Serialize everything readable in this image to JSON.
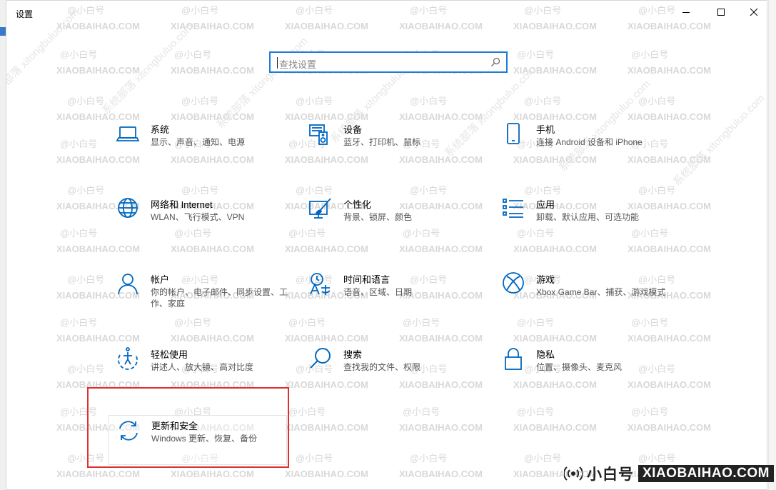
{
  "window": {
    "title": "设置",
    "controls": {
      "minimize": "minimize",
      "maximize": "maximize",
      "close": "close"
    }
  },
  "watermark": {
    "handle": "@小白号",
    "site": "XIAOBAIHAO.COM",
    "diag": "系统部落 xitongbuluo.com",
    "color": "#d8d8d8"
  },
  "search": {
    "placeholder": "查找设置"
  },
  "accent": "#0067c0",
  "tiles": [
    {
      "id": "system",
      "title": "系统",
      "desc": "显示、声音、通知、电源",
      "icon": "laptop-icon"
    },
    {
      "id": "devices",
      "title": "设备",
      "desc": "蓝牙、打印机、鼠标",
      "icon": "devices-icon"
    },
    {
      "id": "phone",
      "title": "手机",
      "desc": "连接 Android 设备和 iPhone",
      "icon": "phone-icon"
    },
    {
      "id": "network",
      "title": "网络和 Internet",
      "desc": "WLAN、飞行模式、VPN",
      "icon": "globe-icon"
    },
    {
      "id": "personalization",
      "title": "个性化",
      "desc": "背景、锁屏、颜色",
      "icon": "paint-icon"
    },
    {
      "id": "apps",
      "title": "应用",
      "desc": "卸载、默认应用、可选功能",
      "icon": "apps-list-icon"
    },
    {
      "id": "accounts",
      "title": "帐户",
      "desc": "你的帐户、电子邮件、同步设置、工作、家庭",
      "icon": "person-icon"
    },
    {
      "id": "time-language",
      "title": "时间和语言",
      "desc": "语音、区域、日期",
      "icon": "time-language-icon"
    },
    {
      "id": "gaming",
      "title": "游戏",
      "desc": "Xbox Game Bar、捕获、游戏模式",
      "icon": "xbox-icon"
    },
    {
      "id": "ease-of-access",
      "title": "轻松使用",
      "desc": "讲述人、放大镜、高对比度",
      "icon": "ease-of-access-icon"
    },
    {
      "id": "search",
      "title": "搜索",
      "desc": "查找我的文件、权限",
      "icon": "search-icon"
    },
    {
      "id": "privacy",
      "title": "隐私",
      "desc": "位置、摄像头、麦克风",
      "icon": "lock-icon"
    },
    {
      "id": "update-security",
      "title": "更新和安全",
      "desc": "Windows 更新、恢复、备份",
      "icon": "sync-icon"
    }
  ],
  "highlight_color": "#e02f2f",
  "brand": {
    "name": "小白号",
    "url": "XIAOBAIHAO.COM"
  }
}
